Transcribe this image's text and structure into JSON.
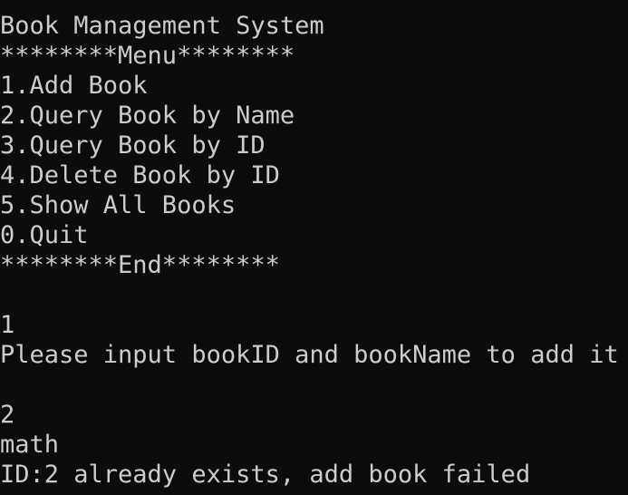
{
  "console": {
    "title_line": "Book Management System",
    "menu_header": "********Menu********",
    "menu_items": [
      "1.Add Book",
      "2.Query Book by Name",
      "3.Query Book by ID",
      "4.Delete Book by ID",
      "5.Show All Books",
      "0.Quit"
    ],
    "menu_footer": "********End********",
    "input_choice": "1",
    "prompt_add": "Please input bookID and bookName to add it",
    "input_book_id": "2",
    "input_book_name": "math",
    "result_message": "ID:2 already exists, add book failed"
  },
  "colors": {
    "background": "#0c0c0c",
    "text": "#cccccc"
  }
}
